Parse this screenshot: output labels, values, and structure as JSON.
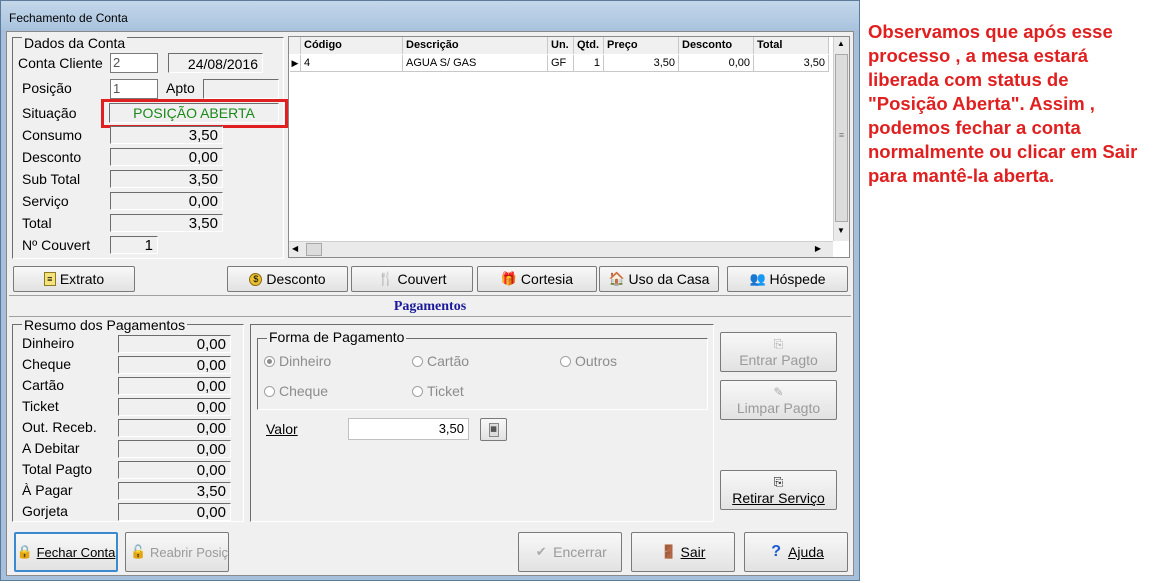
{
  "window": {
    "title": "Fechamento de Conta"
  },
  "dados": {
    "group_label": "Dados da Conta",
    "conta_cliente_label": "Conta Cliente",
    "conta_cliente_value": "2",
    "date": "24/08/2016",
    "posicao_label": "Posição",
    "posicao_value": "1",
    "apto_label": "Apto",
    "apto_value": "",
    "situacao_label": "Situação",
    "situacao_value": "POSIÇÃO ABERTA",
    "consumo_label": "Consumo",
    "consumo_value": "3,50",
    "desconto_label": "Desconto",
    "desconto_value": "0,00",
    "subtotal_label": "Sub Total",
    "subtotal_value": "3,50",
    "servico_label": "Serviço",
    "servico_value": "0,00",
    "total_label": "Total",
    "total_value": "3,50",
    "couvert_label": "Nº Couvert",
    "couvert_value": "1"
  },
  "grid": {
    "headers": [
      "Código",
      "Descrição",
      "Un.",
      "Qtd.",
      "Preço",
      "Desconto",
      "Total"
    ],
    "rows": [
      [
        "4",
        "AGUA S/ GAS",
        "GF",
        "1",
        "3,50",
        "0,00",
        "3,50"
      ]
    ]
  },
  "actions": {
    "extrato": "Extrato",
    "desconto": "Desconto",
    "couvert": "Couvert",
    "cortesia": "Cortesia",
    "uso_casa": "Uso da Casa",
    "hospede": "Hóspede"
  },
  "pagamentos": {
    "title": "Pagamentos",
    "resumo_label": "Resumo dos Pagamentos",
    "resumo": [
      {
        "label": "Dinheiro",
        "value": "0,00"
      },
      {
        "label": "Cheque",
        "value": "0,00"
      },
      {
        "label": "Cartão",
        "value": "0,00"
      },
      {
        "label": "Ticket",
        "value": "0,00"
      },
      {
        "label": "Out. Receb.",
        "value": "0,00"
      },
      {
        "label": "A Debitar",
        "value": "0,00"
      },
      {
        "label": "Total Pagto",
        "value": "0,00"
      },
      {
        "label": "À Pagar",
        "value": "3,50"
      },
      {
        "label": "Gorjeta",
        "value": "0,00"
      }
    ],
    "forma_label": "Forma de Pagamento",
    "options": {
      "dinheiro": "Dinheiro",
      "cartao": "Cartão",
      "outros": "Outros",
      "cheque": "Cheque",
      "ticket": "Ticket"
    },
    "selected": "Dinheiro",
    "valor_label": "Valor",
    "valor_value": "3,50",
    "entrar": "Entrar Pagto",
    "limpar": "Limpar Pagto",
    "retirar": "Retirar Serviço"
  },
  "bottom": {
    "fechar": "Fechar Conta",
    "reabrir": "Reabrir Posiçã",
    "encerrar": "Encerrar",
    "sair": "Sair",
    "ajuda": "Ajuda"
  },
  "annotation": "Observamos que após esse processo , a mesa estará liberada com status de \"Posição Aberta\". Assim , podemos fechar a conta normalmente ou clicar em Sair para mantê-la aberta.",
  "colors": {
    "situacao_text": "#1a8a1a",
    "highlight": "#e02020",
    "pagamentos_title": "#1a1a9a",
    "annotation": "#e02020"
  }
}
